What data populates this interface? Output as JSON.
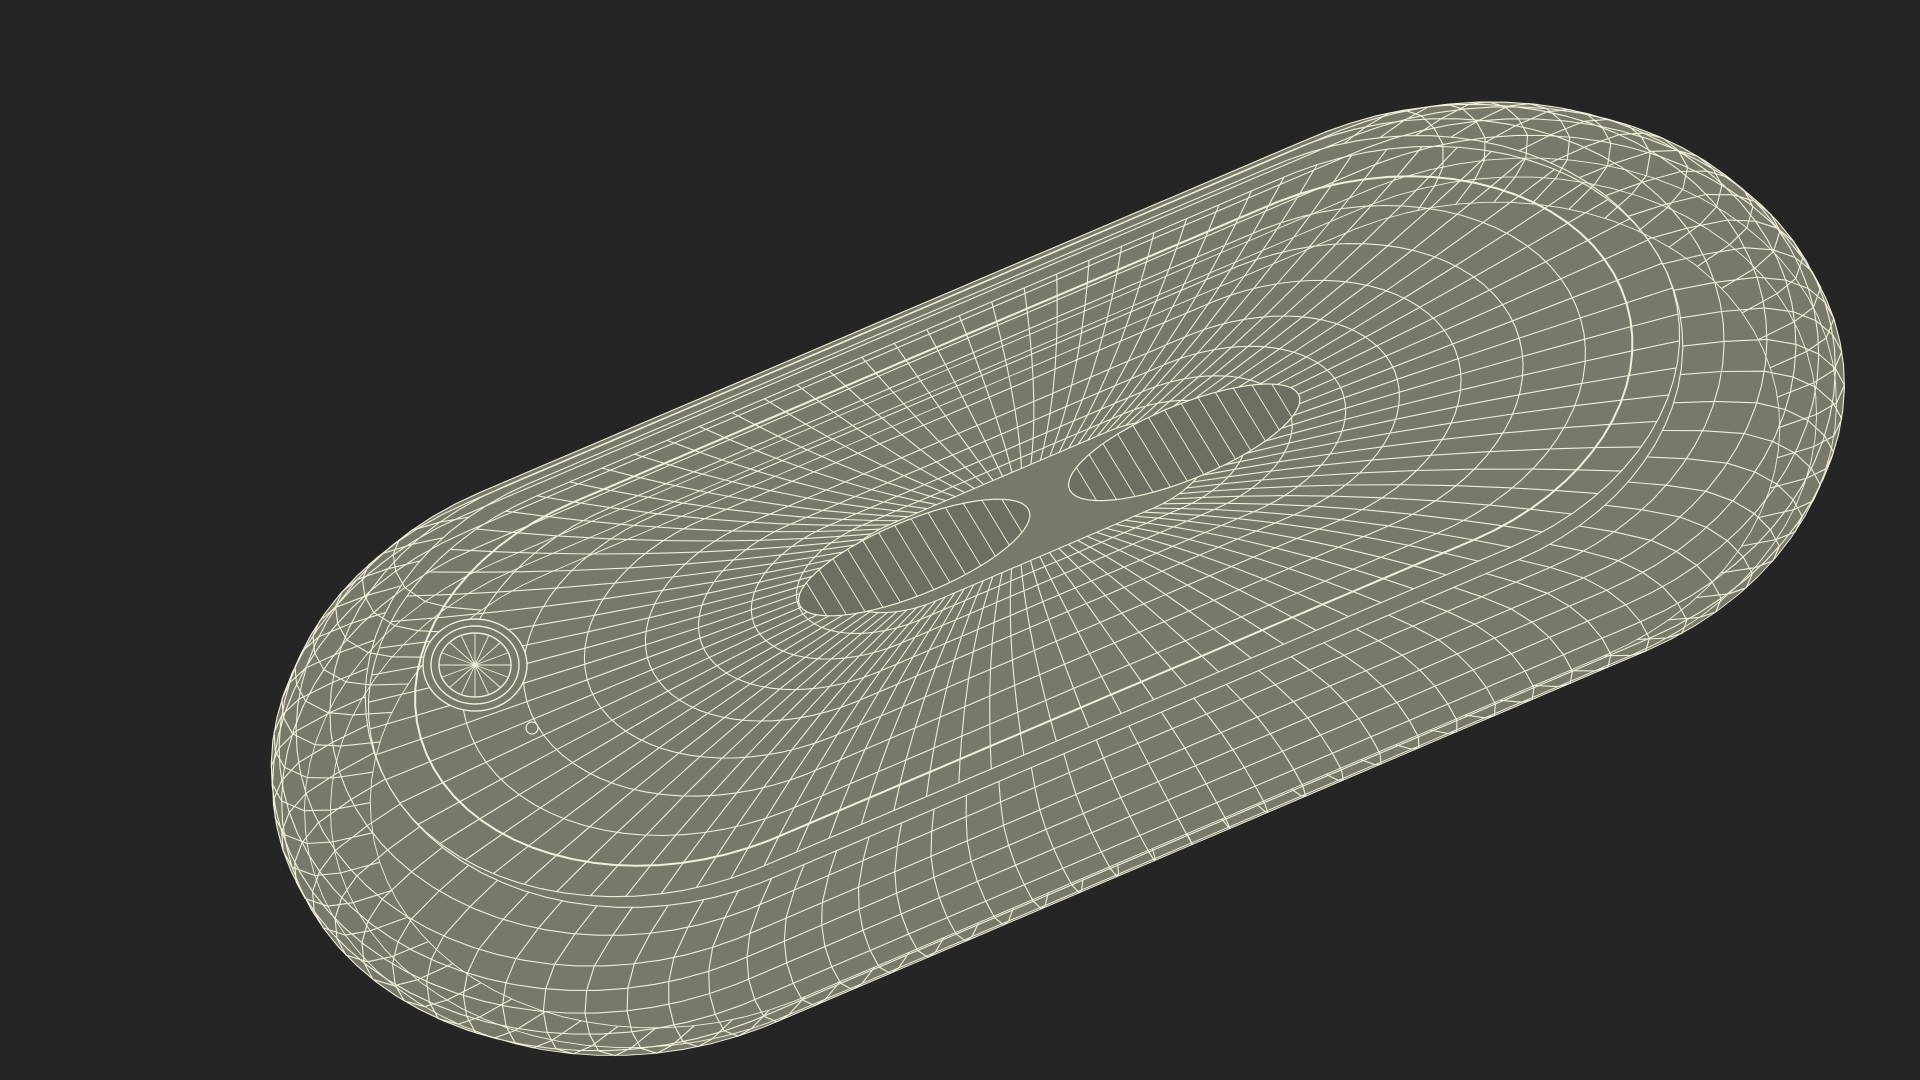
{
  "scene": {
    "background_color": "#252525",
    "mesh_fill_color": "#79796a",
    "mesh_fill_shadow": "#6f6f61",
    "wire_color": "#f1efd8",
    "object": "wireframe-capsule-device",
    "features": [
      "recessed-top-panel",
      "round-button",
      "center-slot"
    ]
  }
}
